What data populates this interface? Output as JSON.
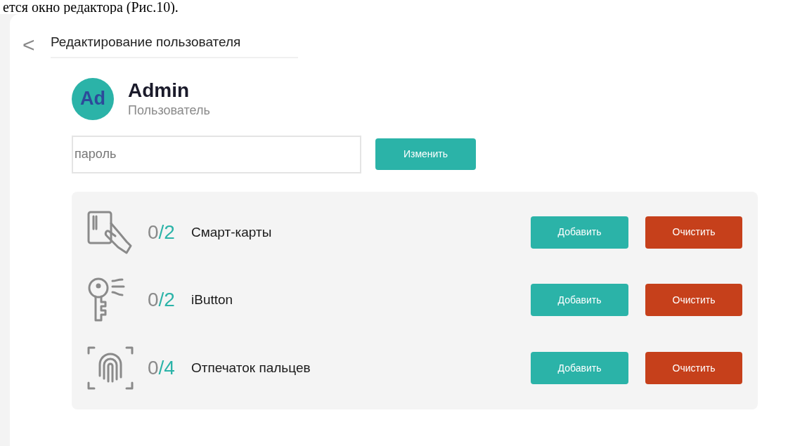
{
  "document_text": "ется окно редактора (Рис.10).",
  "header": {
    "back": "<",
    "title": "Редактирование пользователя"
  },
  "user": {
    "initials": "Ad",
    "name": "Admin",
    "role": "Пользователь"
  },
  "password": {
    "placeholder": "пароль",
    "button": "Изменить"
  },
  "credentials": [
    {
      "kind": "card",
      "count": "0",
      "limit": "/2",
      "label": "Смарт-карты",
      "add": "Добавить",
      "clear": "Очистить"
    },
    {
      "kind": "key",
      "count": "0",
      "limit": "/2",
      "label": "iButton",
      "add": "Добавить",
      "clear": "Очистить"
    },
    {
      "kind": "fingerprint",
      "count": "0",
      "limit": "/4",
      "label": "Отпечаток пальцев",
      "add": "Добавить",
      "clear": "Очистить"
    }
  ]
}
